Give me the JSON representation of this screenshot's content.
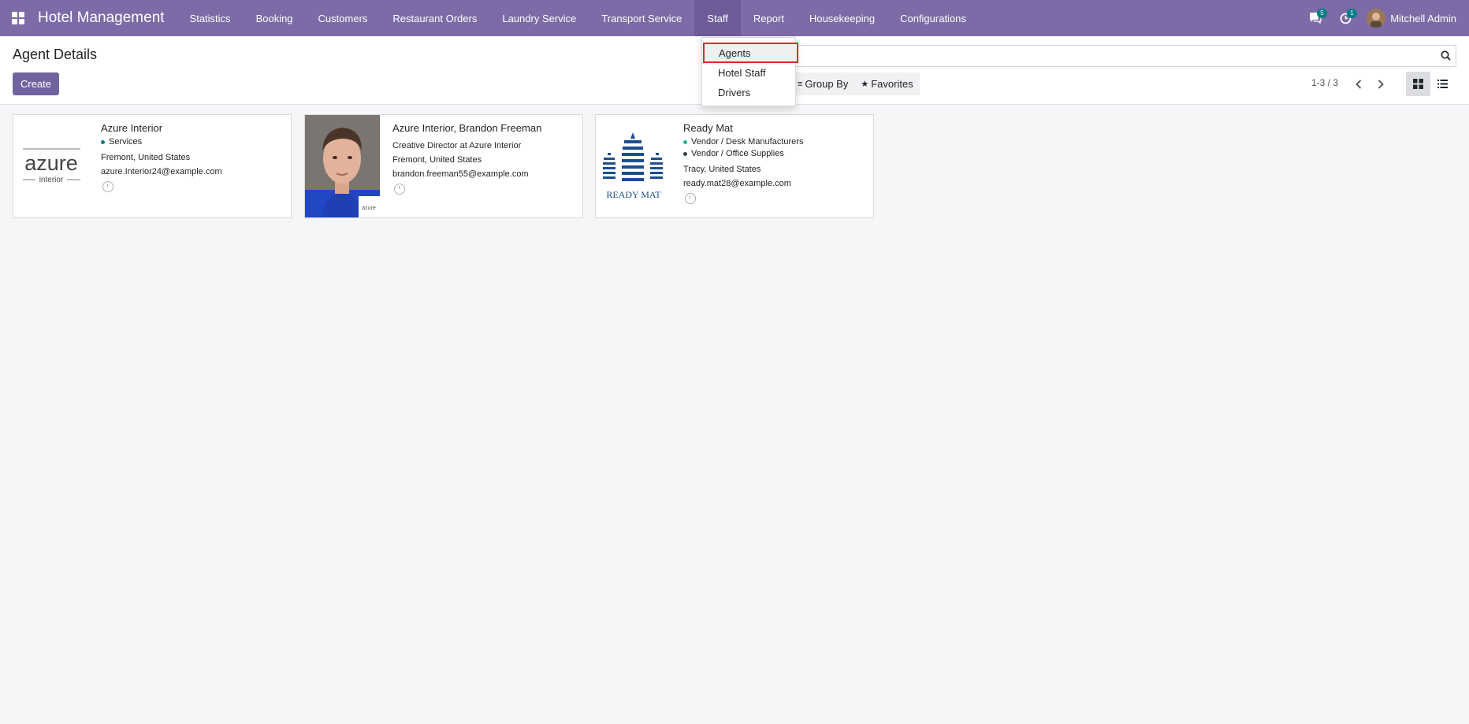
{
  "navbar": {
    "brand": "Hotel Management",
    "menu": [
      {
        "label": "Statistics"
      },
      {
        "label": "Booking"
      },
      {
        "label": "Customers"
      },
      {
        "label": "Restaurant Orders"
      },
      {
        "label": "Laundry Service"
      },
      {
        "label": "Transport Service"
      },
      {
        "label": "Staff"
      },
      {
        "label": "Report"
      },
      {
        "label": "Housekeeping"
      },
      {
        "label": "Configurations"
      }
    ],
    "messages_count": "5",
    "activities_count": "1",
    "user_name": "Mitchell Admin",
    "color": "#7c6ba6"
  },
  "dropdown": {
    "items": [
      {
        "label": "Agents"
      },
      {
        "label": "Hotel Staff"
      },
      {
        "label": "Drivers"
      }
    ]
  },
  "control_panel": {
    "title": "Agent Details",
    "create_label": "Create",
    "group_by_label": "Group By",
    "favorites_label": "Favorites",
    "pager": "1-3 / 3"
  },
  "cards": [
    {
      "name": "Azure Interior",
      "logo_text": "azure",
      "logo_sub": "interior",
      "tags": [
        {
          "label": "Services",
          "color": "#017e84"
        }
      ],
      "location": "Fremont, United States",
      "email": "azure.Interior24@example.com"
    },
    {
      "name": "Azure Interior, Brandon Freeman",
      "function": "Creative Director at Azure Interior",
      "location": "Fremont, United States",
      "email": "brandon.freeman55@example.com"
    },
    {
      "name": "Ready Mat",
      "logo_text": "READY MAT",
      "tags": [
        {
          "label": "Vendor / Desk Manufacturers",
          "color": "#21b799"
        },
        {
          "label": "Vendor / Office Supplies",
          "color": "#374151"
        }
      ],
      "location": "Tracy, United States",
      "email": "ready.mat28@example.com"
    }
  ]
}
